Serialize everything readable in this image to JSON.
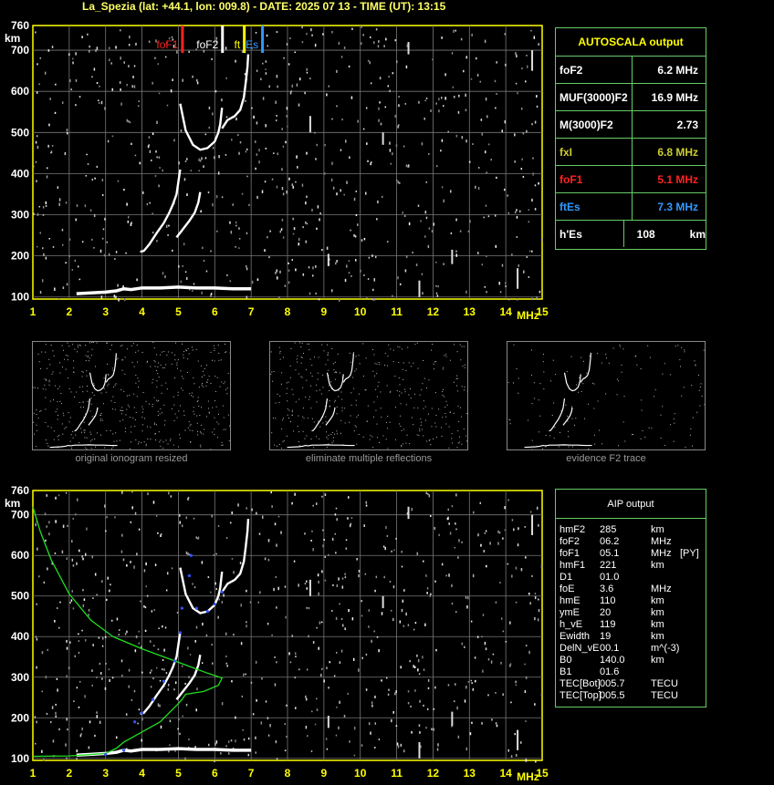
{
  "header": {
    "title": "La_Spezia (lat: +44.1, lon: 009.8) - DATE: 2025 07 13 - TIME (UT): 13:15"
  },
  "autoscala": {
    "title": "AUTOSCALA output",
    "rows": [
      {
        "label": "foF2",
        "value": "6.2 MHz",
        "color": "#ffffff"
      },
      {
        "label": "MUF(3000)F2",
        "value": "16.9 MHz",
        "color": "#ffffff"
      },
      {
        "label": "M(3000)F2",
        "value": "2.73",
        "color": "#ffffff"
      },
      {
        "label": "fxI",
        "value": "6.8 MHz",
        "color": "#cccc33"
      },
      {
        "label": "foF1",
        "value": "5.1 MHz",
        "color": "#ff2222"
      },
      {
        "label": "ftEs",
        "value": "7.3 MHz",
        "color": "#3399ff"
      },
      {
        "label": "h'Es",
        "value": "108",
        "unit": "km",
        "color": "#ffffff"
      }
    ]
  },
  "captions": {
    "thumb1": "original ionogram resized",
    "thumb2": "eliminate multiple reflections",
    "thumb3": "evidence F2 trace"
  },
  "aip": {
    "title": "AIP output",
    "rows": [
      {
        "name": "hmF2",
        "value": "285",
        "unit": "km",
        "extra": ""
      },
      {
        "name": "foF2",
        "value": "06.2",
        "unit": "MHz",
        "extra": ""
      },
      {
        "name": "foF1",
        "value": "05.1",
        "unit": "MHz",
        "extra": "[PY]"
      },
      {
        "name": "hmF1",
        "value": "221",
        "unit": "km",
        "extra": ""
      },
      {
        "name": "D1",
        "value": "01.0",
        "unit": "",
        "extra": ""
      },
      {
        "name": "foE",
        "value": "3.6",
        "unit": "MHz",
        "extra": ""
      },
      {
        "name": "hmE",
        "value": "110",
        "unit": "km",
        "extra": ""
      },
      {
        "name": "ymE",
        "value": "20",
        "unit": "km",
        "extra": ""
      },
      {
        "name": "h_vE",
        "value": "119",
        "unit": "km",
        "extra": ""
      },
      {
        "name": "Ewidth",
        "value": "19",
        "unit": "km",
        "extra": ""
      },
      {
        "name": "DelN_vE",
        "value": "00.1",
        "unit": "m^(-3)",
        "extra": ""
      },
      {
        "name": "B0",
        "value": "140.0",
        "unit": "km",
        "extra": ""
      },
      {
        "name": "B1",
        "value": "01.6",
        "unit": "",
        "extra": ""
      },
      {
        "name": "TEC[Bot]",
        "value": "005.7",
        "unit": "TECU",
        "extra": ""
      },
      {
        "name": "TEC[Top]",
        "value": "005.5",
        "unit": "TECU",
        "extra": ""
      }
    ]
  },
  "chart_data": {
    "type": "scatter",
    "xunit": "MHz",
    "yunit": "km",
    "xlim": [
      1,
      15
    ],
    "ylim": [
      95,
      760
    ],
    "xticks": [
      1,
      2,
      3,
      4,
      5,
      6,
      7,
      8,
      9,
      10,
      11,
      12,
      13,
      14,
      15
    ],
    "yticks": [
      100,
      200,
      300,
      400,
      500,
      600,
      700,
      760
    ],
    "grid": true,
    "markers": [
      {
        "label": "foF1",
        "x": 5.1,
        "color": "#ff2222"
      },
      {
        "label": "foF2",
        "x": 6.2,
        "color": "#ffffff"
      },
      {
        "label": "ft",
        "x": 6.8,
        "color": "#ffff00"
      },
      {
        "label": "Es",
        "x": 7.3,
        "color": "#3399ff"
      }
    ],
    "traces": {
      "E_trace": [
        [
          2.2,
          108
        ],
        [
          2.6,
          110
        ],
        [
          3.0,
          112
        ],
        [
          3.3,
          115
        ],
        [
          3.5,
          120
        ],
        [
          3.7,
          118
        ],
        [
          4.0,
          122
        ],
        [
          4.5,
          122
        ],
        [
          5.0,
          124
        ],
        [
          5.5,
          122
        ],
        [
          6.0,
          122
        ],
        [
          6.5,
          120
        ],
        [
          7.0,
          120
        ]
      ],
      "F1_o": [
        [
          3.95,
          210
        ],
        [
          4.05,
          212
        ],
        [
          4.2,
          228
        ],
        [
          4.4,
          255
        ],
        [
          4.6,
          280
        ],
        [
          4.75,
          305
        ],
        [
          4.85,
          325
        ],
        [
          4.95,
          350
        ],
        [
          5.0,
          380
        ],
        [
          5.05,
          410
        ]
      ],
      "F1_x": [
        [
          4.95,
          245
        ],
        [
          5.1,
          262
        ],
        [
          5.3,
          285
        ],
        [
          5.45,
          305
        ],
        [
          5.55,
          330
        ],
        [
          5.6,
          355
        ]
      ],
      "F2_o": [
        [
          5.05,
          570
        ],
        [
          5.2,
          505
        ],
        [
          5.4,
          470
        ],
        [
          5.6,
          458
        ],
        [
          5.8,
          462
        ],
        [
          6.0,
          478
        ],
        [
          6.1,
          500
        ],
        [
          6.15,
          520
        ],
        [
          6.2,
          560
        ]
      ],
      "F2_x": [
        [
          6.2,
          510
        ],
        [
          6.35,
          530
        ],
        [
          6.55,
          540
        ],
        [
          6.7,
          555
        ],
        [
          6.8,
          585
        ],
        [
          6.85,
          620
        ],
        [
          6.9,
          660
        ],
        [
          6.92,
          690
        ]
      ],
      "profile_green": [
        [
          1.0,
          720
        ],
        [
          1.2,
          660
        ],
        [
          1.5,
          590
        ],
        [
          2.0,
          505
        ],
        [
          2.6,
          440
        ],
        [
          3.2,
          400
        ],
        [
          4.0,
          370
        ],
        [
          4.6,
          350
        ],
        [
          5.2,
          330
        ],
        [
          5.8,
          310
        ],
        [
          6.2,
          298
        ],
        [
          6.1,
          280
        ],
        [
          5.7,
          265
        ],
        [
          5.2,
          258
        ],
        [
          5.1,
          245
        ],
        [
          5.0,
          235
        ],
        [
          4.5,
          190
        ],
        [
          3.9,
          160
        ],
        [
          3.5,
          140
        ],
        [
          3.3,
          125
        ],
        [
          3.0,
          112
        ],
        [
          2.0,
          106
        ],
        [
          1.0,
          105
        ]
      ],
      "blue_model": [
        [
          3.0,
          110
        ],
        [
          3.5,
          120
        ],
        [
          3.8,
          190
        ],
        [
          4.0,
          212
        ],
        [
          4.3,
          245
        ],
        [
          4.6,
          290
        ],
        [
          4.9,
          340
        ],
        [
          5.05,
          410
        ],
        [
          5.1,
          470
        ],
        [
          5.3,
          550
        ],
        [
          5.35,
          600
        ],
        [
          5.5,
          470
        ],
        [
          5.8,
          462
        ],
        [
          6.0,
          480
        ],
        [
          6.2,
          510
        ]
      ]
    }
  }
}
